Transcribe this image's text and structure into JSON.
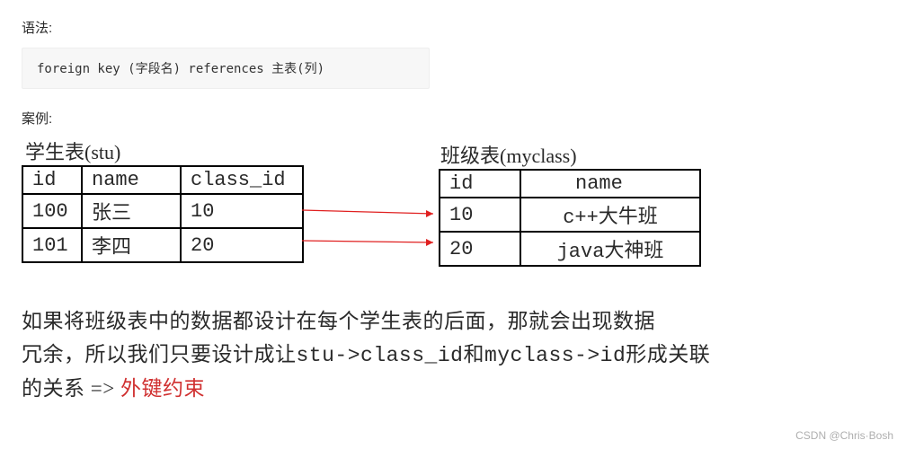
{
  "syntax_label": "语法:",
  "code": "foreign key (字段名) references 主表(列)",
  "case_label": "案例:",
  "stu": {
    "caption": "学生表(stu)",
    "headers": [
      "id",
      "name",
      "class_id"
    ],
    "rows": [
      [
        "100",
        "张三",
        "10"
      ],
      [
        "101",
        "李四",
        "20"
      ]
    ]
  },
  "myclass": {
    "caption": "班级表(myclass)",
    "headers": [
      "id",
      "name"
    ],
    "rows": [
      [
        "10",
        "c++大牛班"
      ],
      [
        "20",
        "java大神班"
      ]
    ]
  },
  "explain": {
    "line1": "如果将班级表中的数据都设计在每个学生表的后面，那就会出现数据",
    "line2a": "冗余，所以我们只要设计成让",
    "line2b": "stu->class_id",
    "line2c": "和",
    "line2d": "myclass->id",
    "line2e": "形成关联",
    "line3a": "的关系 =>",
    "line3b": " 外键约束"
  },
  "watermark": "CSDN @Chris·Bosh"
}
